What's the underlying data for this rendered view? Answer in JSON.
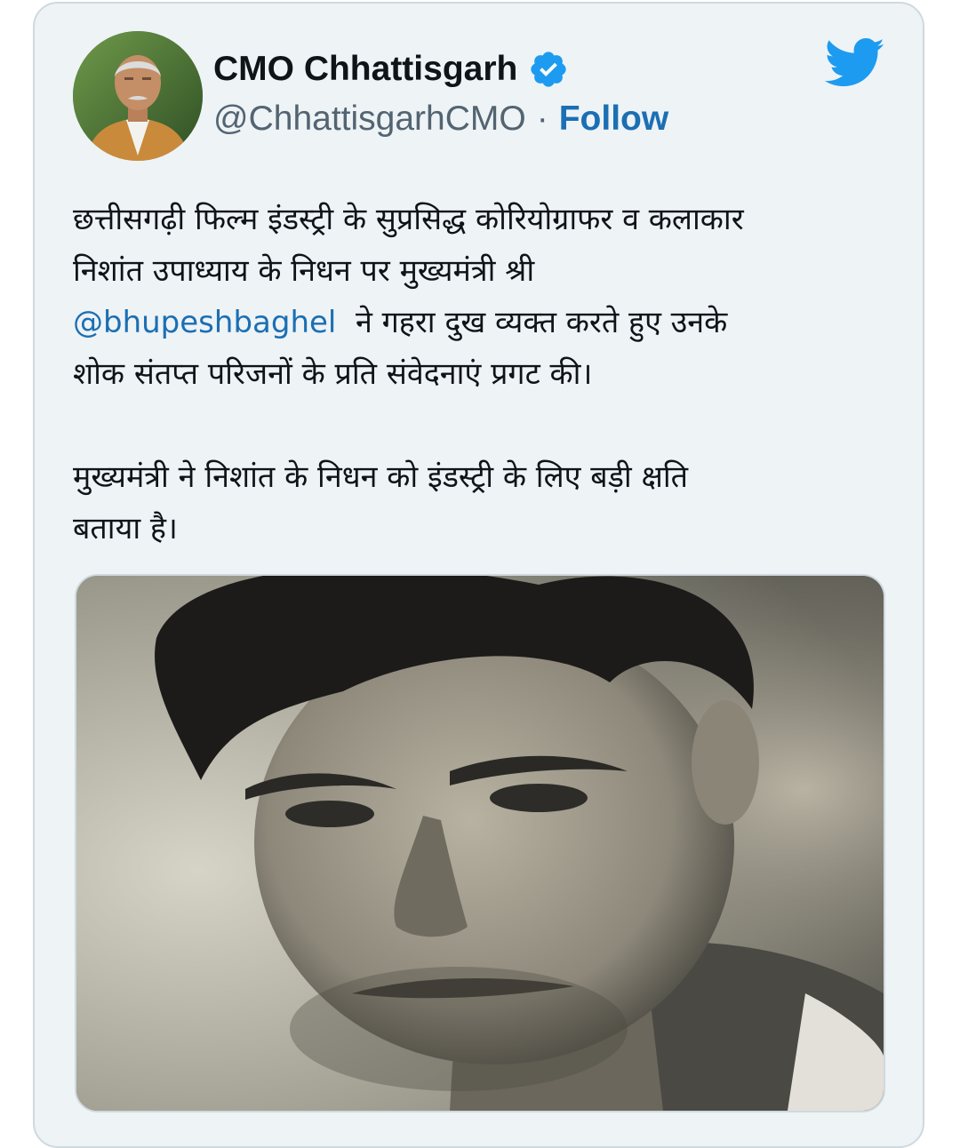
{
  "tweet": {
    "author": {
      "display_name": "CMO Chhattisgarh",
      "handle": "@ChhattisgarhCMO",
      "verified": true,
      "avatar_icon": "profile-photo"
    },
    "separator": "·",
    "follow_label": "Follow",
    "logo_icon": "twitter-bird-icon",
    "text": {
      "line1": "छत्तीसगढ़ी फिल्म इंडस्ट्री के सुप्रसिद्ध कोरियोग्राफर व कलाकार",
      "line2": "निशांत उपाध्याय के निधन पर मुख्यमंत्री श्री",
      "mention": "@bhupeshbaghel",
      "line3_rest": "ने गहरा दुख व्यक्त करते हुए उनके",
      "line4": "शोक संतप्त परिजनों के प्रति संवेदनाएं प्रगट की।",
      "line5": "मुख्यमंत्री ने निशांत के निधन को इंडस्ट्री के लिए बड़ी क्षति",
      "line6": "बताया है।"
    },
    "media": {
      "type": "photo",
      "style": "sepia black-and-white portrait"
    }
  },
  "colors": {
    "link": "#1b6fb3",
    "twitter_blue": "#1d9bf0",
    "card_background": "#eef3f6",
    "card_border": "#cfd9de",
    "text": "#0f1419",
    "secondary_text": "#536471"
  }
}
